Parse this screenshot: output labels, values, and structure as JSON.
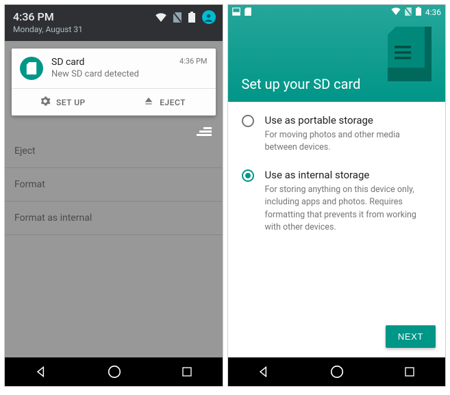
{
  "left": {
    "status": {
      "time": "4:36 PM",
      "date": "Monday, August 31"
    },
    "notification": {
      "title": "SD card",
      "subtitle": "New SD card detected",
      "time": "4:36 PM",
      "action_setup": "SET UP",
      "action_eject": "EJECT"
    },
    "bg_items": [
      "Eject",
      "Format",
      "Format as internal"
    ]
  },
  "right": {
    "status_time": "4:36",
    "header_title": "Set up your SD card",
    "options": [
      {
        "title": "Use as portable storage",
        "desc": "For moving photos and other media between devices.",
        "selected": false
      },
      {
        "title": "Use as internal storage",
        "desc": "For storing anything on this device only, including apps and photos. Requires formatting that prevents it from working with other devices.",
        "selected": true
      }
    ],
    "next_label": "NEXT"
  }
}
